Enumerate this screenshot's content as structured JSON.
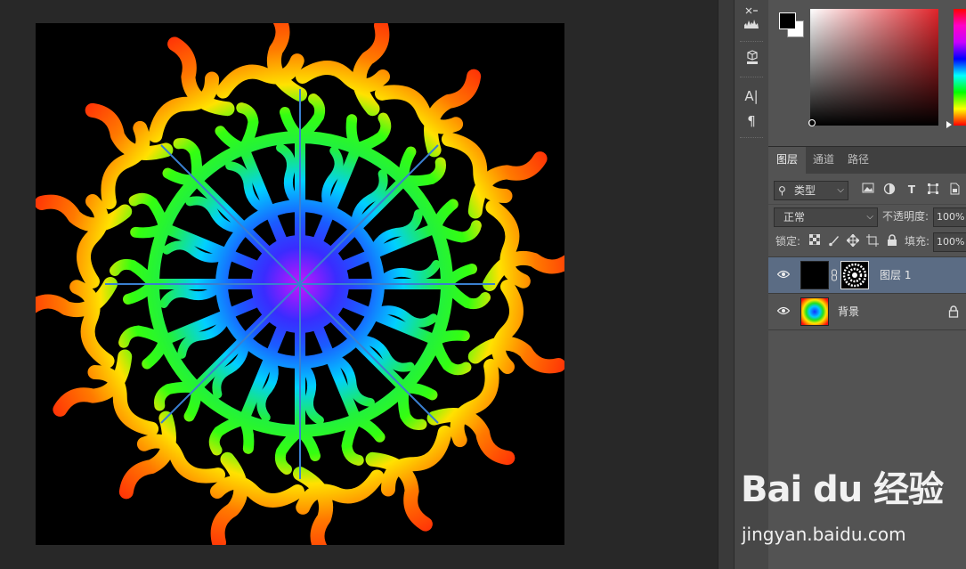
{
  "layers_panel": {
    "tabs": [
      "图层",
      "通道",
      "路径"
    ],
    "kind_filter": "类型",
    "blend_mode": "正常",
    "opacity_label": "不透明度:",
    "opacity_value": "100%",
    "lock_label": "锁定:",
    "fill_label": "填充:",
    "fill_value": "100%",
    "layers": [
      {
        "name": "图层 1",
        "selected": true
      },
      {
        "name": "背景",
        "locked": true
      }
    ]
  },
  "toolbar": {
    "text_tool": "A|",
    "paragraph_tool": "¶"
  },
  "color_panel": {
    "foreground": "#000000",
    "background": "#ffffff"
  },
  "watermark": {
    "logo": "Bai du 经验",
    "url": "jingyan.baidu.com"
  },
  "colors": {
    "workspace": "#282828",
    "panel": "#535353",
    "selected_layer": "#5b6c84",
    "guide_line": "#3a7fd0"
  }
}
